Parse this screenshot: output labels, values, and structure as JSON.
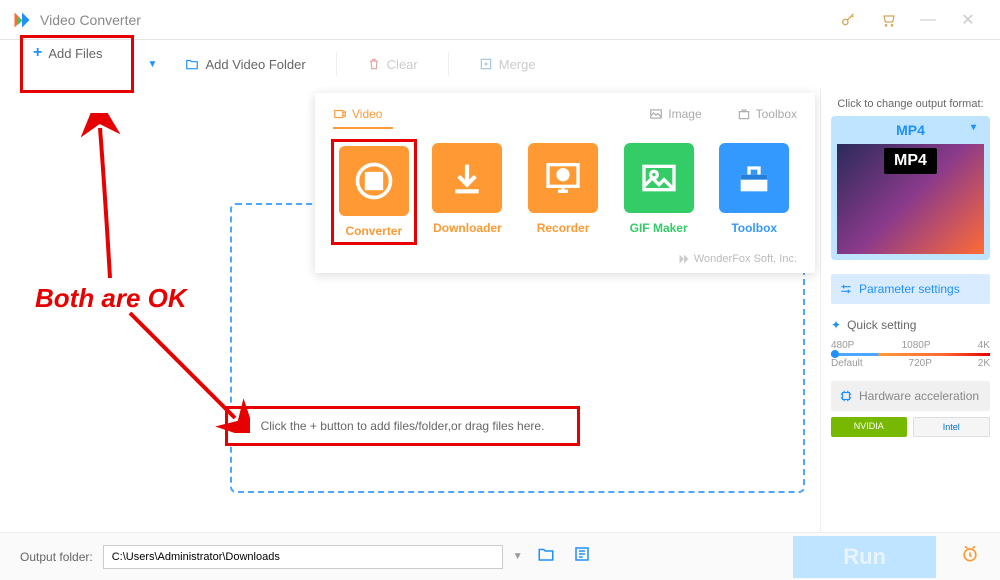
{
  "title": "Video Converter",
  "toolbar": {
    "add_files": "Add Files",
    "add_folder": "Add Video Folder",
    "clear": "Clear",
    "merge": "Merge"
  },
  "tool_panel": {
    "tabs": {
      "video": "Video",
      "image": "Image",
      "toolbox": "Toolbox"
    },
    "items": [
      {
        "label": "Converter",
        "color": "#ff9933"
      },
      {
        "label": "Downloader",
        "color": "#ff9933"
      },
      {
        "label": "Recorder",
        "color": "#ff9933"
      },
      {
        "label": "GIF Maker",
        "color": "#33cc66"
      },
      {
        "label": "Toolbox",
        "color": "#3399ff"
      }
    ],
    "footer": "WonderFox Soft, Inc."
  },
  "dropzone_text": "Click the + button to add files/folder,or drag files here.",
  "annotation": "Both are OK",
  "sidebar": {
    "format_label": "Click to change output format:",
    "format": "MP4",
    "param_btn": "Parameter settings",
    "quick_setting": "Quick setting",
    "qs_top": [
      "480P",
      "1080P",
      "4K"
    ],
    "qs_bottom": [
      "Default",
      "720P",
      "2K"
    ],
    "hw_btn": "Hardware acceleration",
    "nvidia": "NVIDIA",
    "intel": "Intel"
  },
  "bottombar": {
    "label": "Output folder:",
    "path": "C:\\Users\\Administrator\\Downloads",
    "run": "Run"
  }
}
